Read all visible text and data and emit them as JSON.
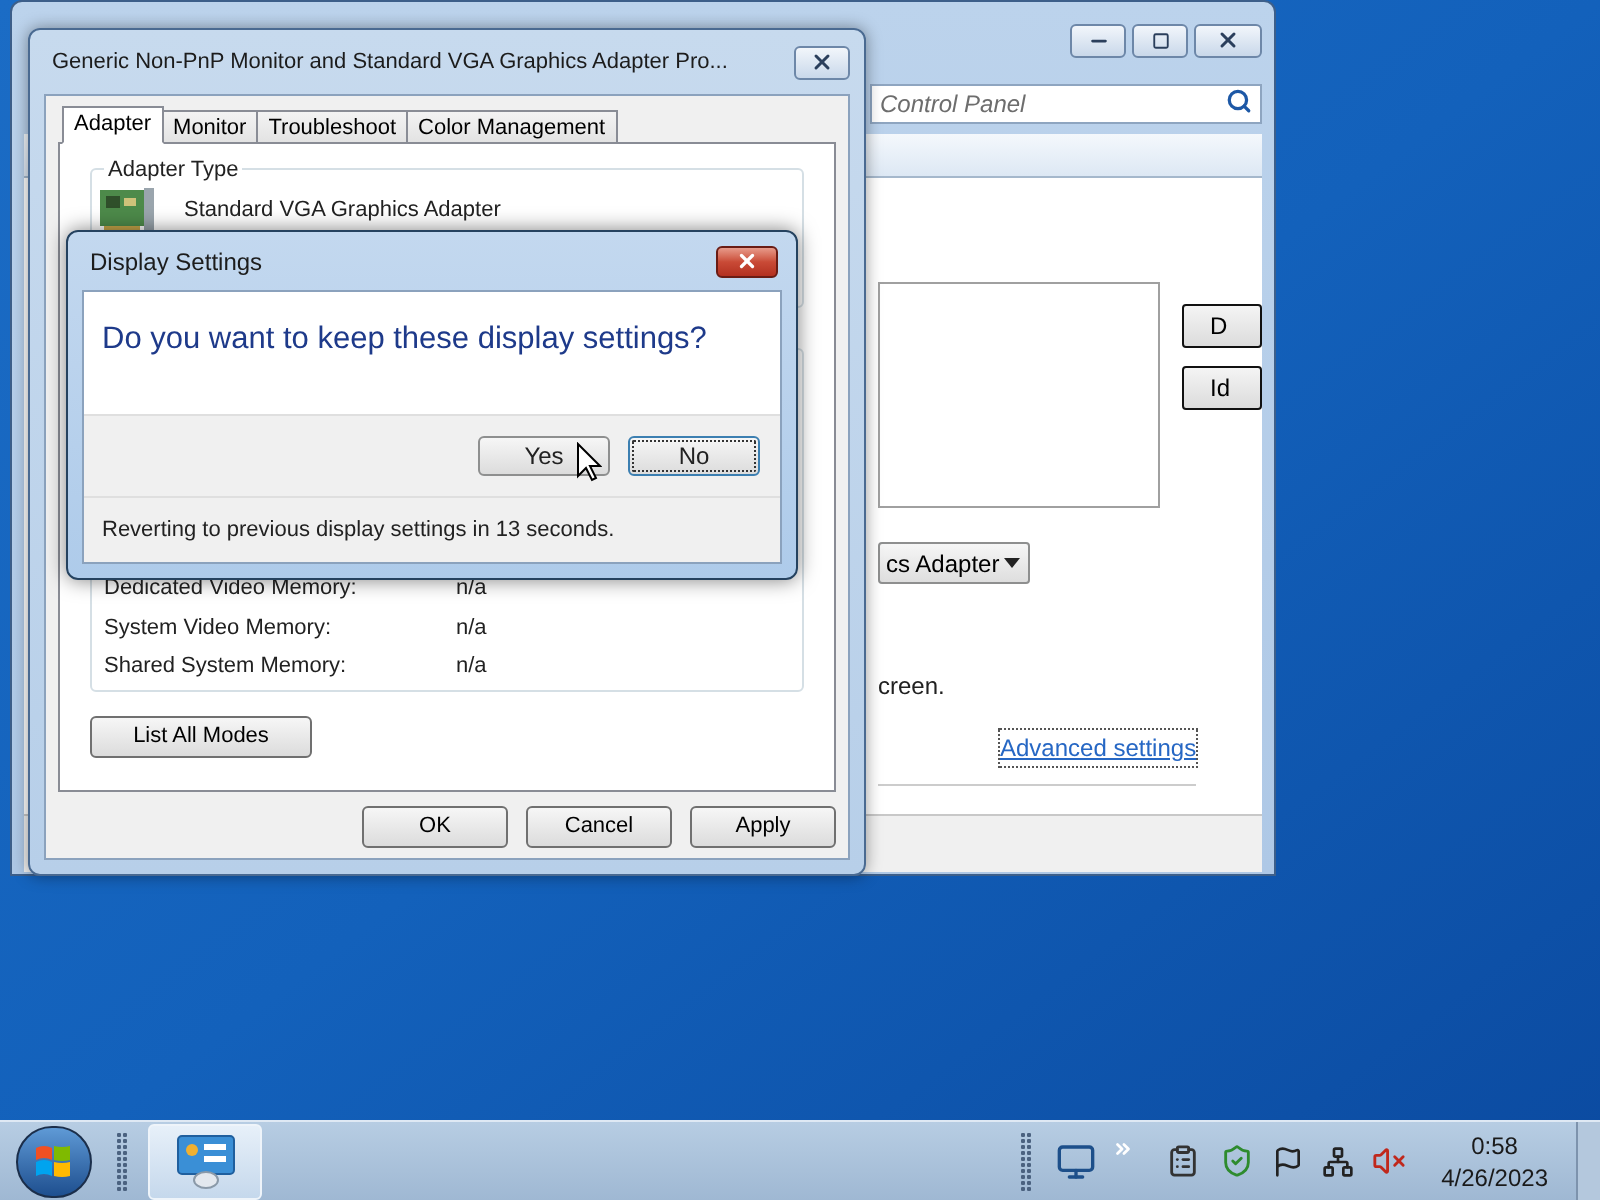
{
  "control_panel": {
    "search_placeholder": "Control Panel",
    "side_buttons": [
      "D",
      "Id"
    ],
    "dropdown_value": "cs Adapter",
    "text": "creen.",
    "link": "Advanced settings"
  },
  "properties": {
    "title": "Generic Non-PnP Monitor and Standard VGA Graphics Adapter Pro...",
    "tabs": [
      {
        "label": "Adapter",
        "selected": true
      },
      {
        "label": "Monitor",
        "selected": false
      },
      {
        "label": "Troubleshoot",
        "selected": false
      },
      {
        "label": "Color Management",
        "selected": false
      }
    ],
    "adapter_type": {
      "label": "Adapter Type",
      "name": "Standard VGA Graphics Adapter"
    },
    "memory_rows": [
      {
        "label": "Dedicated Video Memory:",
        "value": "n/a"
      },
      {
        "label": "System Video Memory:",
        "value": "n/a"
      },
      {
        "label": "Shared System Memory:",
        "value": "n/a"
      }
    ],
    "list_modes_button": "List All Modes",
    "buttons": [
      "OK",
      "Cancel",
      "Apply"
    ]
  },
  "dialog": {
    "title": "Display Settings",
    "question": "Do you want to keep these display settings?",
    "buttons": [
      {
        "label": "Yes",
        "focused": false
      },
      {
        "label": "No",
        "focused": true
      }
    ],
    "footer": "Reverting to previous display settings in 13 seconds."
  },
  "taskbar": {
    "time": "0:58",
    "date": "4/26/2023"
  }
}
